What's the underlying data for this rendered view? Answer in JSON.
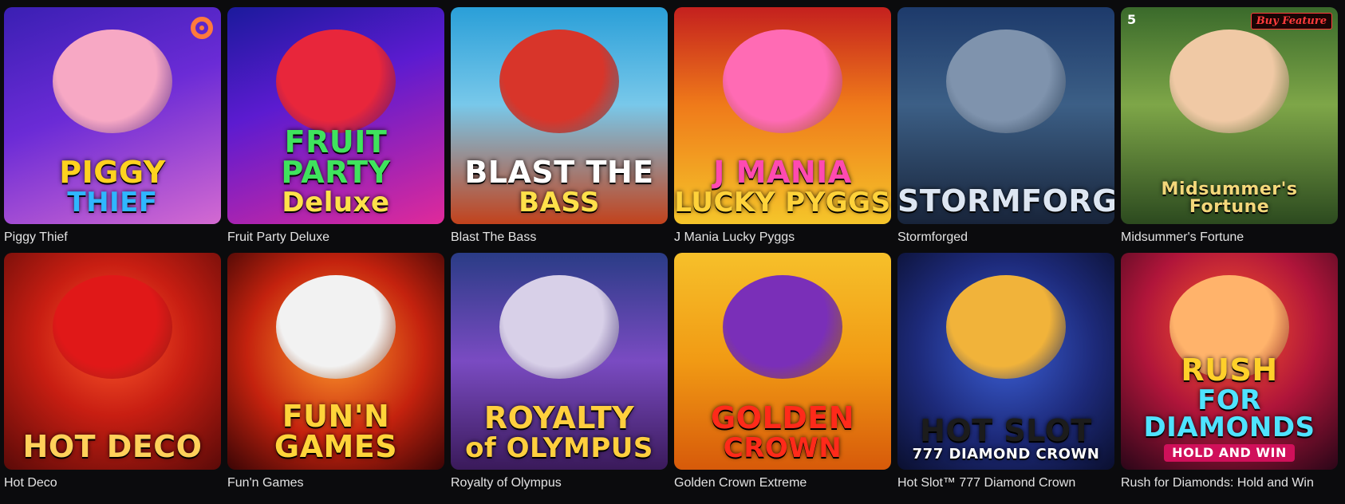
{
  "games": [
    {
      "name": "Piggy Thief",
      "art": {
        "title": "PIGGY",
        "sub": "THIEF",
        "bg": "linear-gradient(160deg,#3a1fb3 0%,#6b2bd6 45%,#d46ad1 100%)",
        "title_color": "#ffd21f",
        "sub_color": "#2fb6ff",
        "mascot": "#f7a8c4"
      }
    },
    {
      "name": "Fruit Party Deluxe",
      "art": {
        "title": "FRUIT PARTY",
        "sub": "Deluxe",
        "bg": "linear-gradient(160deg,#1b1a9c 0%,#5c1bd0 40%,#e02a9a 100%)",
        "title_color": "#3fe35d",
        "sub_color": "#ffe14a",
        "mascot": "#e8263b"
      }
    },
    {
      "name": "Blast The Bass",
      "art": {
        "title": "BLAST THE",
        "sub": "BASS",
        "bg": "linear-gradient(180deg,#2a9fd8 0%,#78c8ea 45%,#c2421c 100%)",
        "title_color": "#ffffff",
        "sub_color": "#ffe04a",
        "mascot": "#d8352a"
      }
    },
    {
      "name": "J Mania Lucky Pyggs",
      "art": {
        "title": "J MANIA",
        "sub": "LUCKY PYGGS",
        "bg": "linear-gradient(180deg,#c4201e 0%,#ef7a1a 45%,#f5c52a 100%)",
        "title_color": "#ff4ab1",
        "sub_color": "#ffd23a",
        "mascot": "#ff6bb4"
      }
    },
    {
      "name": "Stormforged",
      "art": {
        "title": "STORMFORGED",
        "sub": "",
        "bg": "linear-gradient(180deg,#1d3a6b 0%,#3c5f86 45%,#18243a 100%)",
        "title_color": "#dde6f2",
        "sub_color": "#dde6f2",
        "mascot": "#7f93ad"
      }
    },
    {
      "name": "Midsummer's Fortune",
      "art": {
        "title": "Midsummer's Fortune",
        "sub": "",
        "bg": "linear-gradient(180deg,#3a6a2b 0%,#7ea648 45%,#2c4a1f 100%)",
        "title_color": "#f3d77a",
        "sub_color": "#f3d77a",
        "mascot": "#f0c9a5",
        "badge": "Buy Feature",
        "corner": "5"
      }
    },
    {
      "name": "Hot Deco",
      "art": {
        "title": "HOT DECO",
        "sub": "",
        "bg": "radial-gradient(circle at 50% 40%,#ff5a2c 0%,#c81e12 45%,#5a0a08 100%)",
        "title_color": "#ffd05a",
        "sub_color": "#ffd05a",
        "mascot": "#e01818"
      }
    },
    {
      "name": "Fun'n Games",
      "art": {
        "title": "FUN'N GAMES",
        "sub": "",
        "bg": "radial-gradient(circle at 50% 45%,#ff9a2a 0%,#c4220e 55%,#3a0505 100%)",
        "title_color": "#ffd43a",
        "sub_color": "#ffd43a",
        "mascot": "#f2f2f2"
      }
    },
    {
      "name": "Royalty of Olympus",
      "art": {
        "title": "ROYALTY",
        "sub": "of OLYMPUS",
        "bg": "linear-gradient(180deg,#2a3c86 0%,#7a4bc2 50%,#3a1a5a 100%)",
        "title_color": "#ffcf3e",
        "sub_color": "#ffcf3e",
        "mascot": "#d8d0e8"
      }
    },
    {
      "name": "Golden Crown Extreme",
      "art": {
        "title": "GOLDEN",
        "sub": "CROWN",
        "bg": "linear-gradient(180deg,#f6c02a 0%,#f19a14 50%,#d75a0a 100%)",
        "title_color": "#ff2a1a",
        "sub_color": "#ff2a1a",
        "mascot": "#7a2fb8"
      }
    },
    {
      "name": "Hot Slot™ 777 Diamond Crown",
      "art": {
        "title": "HOT SLOT",
        "sub": "777 DIAMOND CROWN",
        "bg": "radial-gradient(circle at 50% 45%,#3b5fd6 0%,#1d2a7a 55%,#0a0f2e 100%)",
        "title_color": "#1c1c1c",
        "sub_color": "#ffffff",
        "mascot": "#f1b33a"
      }
    },
    {
      "name": "Rush for Diamonds: Hold and Win",
      "art": {
        "title": "RUSH",
        "sub": "FOR DIAMONDS",
        "bg": "radial-gradient(circle at 50% 35%,#ff5a2a 0%,#b0153a 50%,#2a0618 100%)",
        "title_color": "#ffd02a",
        "sub_color": "#4fe3ff",
        "mascot": "#ffb36b",
        "footer": "HOLD AND WIN"
      }
    }
  ]
}
